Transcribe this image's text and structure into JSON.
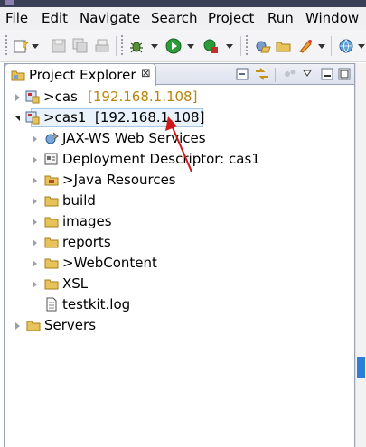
{
  "menubar": {
    "items": [
      "File",
      "Edit",
      "Navigate",
      "Search",
      "Project",
      "Run",
      "Window"
    ]
  },
  "toolbar": {
    "icons": [
      "new-icon",
      "save-icon",
      "save-all-icon",
      "print-icon",
      "debug-icon",
      "run-icon",
      "external-tools-icon",
      "open-project-icon",
      "open-folder-icon",
      "deploy-icon",
      "globe-icon"
    ]
  },
  "explorer": {
    "title": "Project Explorer",
    "close_glyph": "⊠",
    "tree": [
      {
        "label": ">cas",
        "ip": "[192.168.1.108]",
        "icon": "server-project-icon"
      },
      {
        "label": ">cas1",
        "ip": "[192.168.1.108]",
        "icon": "server-project-icon"
      },
      {
        "label": "JAX-WS Web Services",
        "icon": "web-services-icon"
      },
      {
        "label": "Deployment Descriptor: cas1",
        "icon": "deployment-descriptor-icon"
      },
      {
        "label": ">Java Resources",
        "icon": "java-resources-icon"
      },
      {
        "label": "build",
        "icon": "folder-icon"
      },
      {
        "label": "images",
        "icon": "folder-icon"
      },
      {
        "label": "reports",
        "icon": "folder-icon"
      },
      {
        "label": ">WebContent",
        "icon": "folder-icon"
      },
      {
        "label": "XSL",
        "icon": "folder-icon"
      },
      {
        "label": "testkit.log",
        "icon": "file-icon"
      },
      {
        "label": "Servers",
        "icon": "folder-icon"
      }
    ]
  },
  "colors": {
    "selection_border": "#a6c8e6",
    "ip_text": "#b8860b",
    "annotation_arrow": "#d01818",
    "folder": "#e8c25a"
  }
}
